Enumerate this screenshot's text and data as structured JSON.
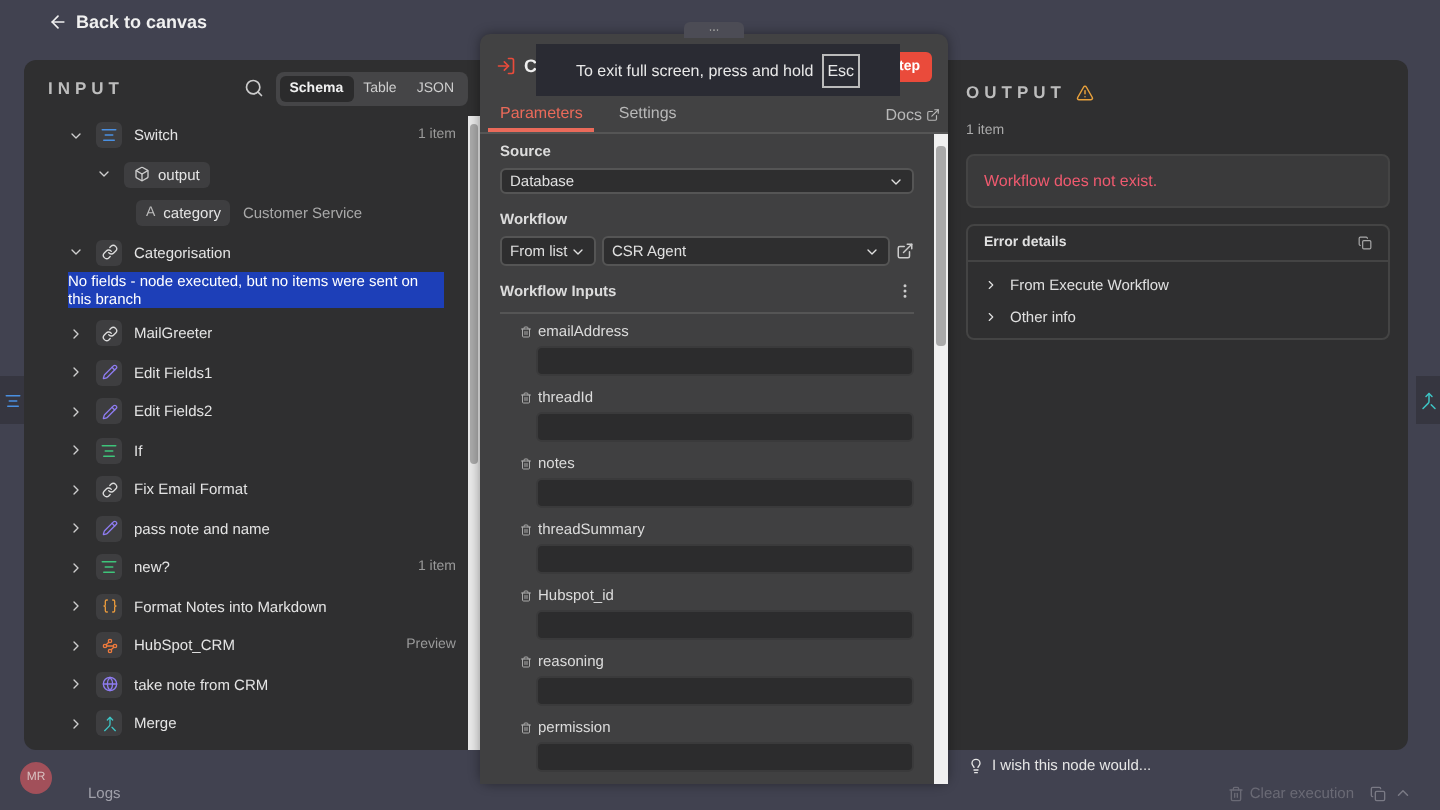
{
  "top_bar": {
    "back_label": "Back to canvas"
  },
  "input_panel": {
    "title": "INPUT",
    "view_tabs": [
      {
        "label": "Schema",
        "selected": true
      },
      {
        "label": "Table",
        "selected": false
      },
      {
        "label": "JSON",
        "selected": false
      }
    ],
    "tree": [
      {
        "name": "Switch",
        "kind": "switch",
        "meta": "1 item",
        "expanded": true,
        "children": [
          {
            "name": "output",
            "kind": "object",
            "expanded": true,
            "children": [
              {
                "name": "category",
                "type_icon": "A",
                "value": "Customer Service"
              }
            ]
          }
        ]
      },
      {
        "name": "Categorisation",
        "kind": "http",
        "expanded": true,
        "message": "No fields - node executed, but no items were sent on this branch"
      },
      {
        "name": "MailGreeter",
        "kind": "http",
        "expanded": false
      },
      {
        "name": "Edit Fields1",
        "kind": "set",
        "expanded": false
      },
      {
        "name": "Edit Fields2",
        "kind": "set",
        "expanded": false
      },
      {
        "name": "If",
        "kind": "condition",
        "expanded": false
      },
      {
        "name": "Fix Email Format",
        "kind": "http",
        "expanded": false
      },
      {
        "name": "pass note and name",
        "kind": "set",
        "expanded": false
      },
      {
        "name": "new?",
        "kind": "condition",
        "meta": "1 item",
        "expanded": false
      },
      {
        "name": "Format Notes into Markdown",
        "kind": "code",
        "expanded": false
      },
      {
        "name": "HubSpot_CRM",
        "kind": "crm",
        "meta": "Preview",
        "expanded": false
      },
      {
        "name": "take note from CRM",
        "kind": "request",
        "expanded": false
      },
      {
        "name": "Merge",
        "kind": "merge",
        "expanded": false
      }
    ]
  },
  "node_panel": {
    "title": "C",
    "execute_button": "tep",
    "tabs": [
      {
        "label": "Parameters",
        "selected": true
      },
      {
        "label": "Settings",
        "selected": false
      }
    ],
    "docs_link": "Docs",
    "source": {
      "label": "Source",
      "value": "Database"
    },
    "workflow": {
      "label": "Workflow",
      "mode": "From list",
      "value": "CSR Agent"
    },
    "workflow_inputs": {
      "label": "Workflow Inputs",
      "fields": [
        {
          "name": "emailAddress"
        },
        {
          "name": "threadId"
        },
        {
          "name": "notes"
        },
        {
          "name": "threadSummary"
        },
        {
          "name": "Hubspot_id"
        },
        {
          "name": "reasoning"
        },
        {
          "name": "permission"
        }
      ]
    }
  },
  "toast": {
    "text": "To exit full screen, press and hold",
    "key": "Esc"
  },
  "output_panel": {
    "title": "OUTPUT",
    "count": "1 item",
    "error": "Workflow does not exist.",
    "details": {
      "title": "Error details",
      "items": [
        "From Execute Workflow",
        "Other info"
      ]
    }
  },
  "feedback": "I wish this node would...",
  "bottom_bar": {
    "avatar": "MR",
    "logs": "Logs",
    "clear": "Clear execution"
  }
}
